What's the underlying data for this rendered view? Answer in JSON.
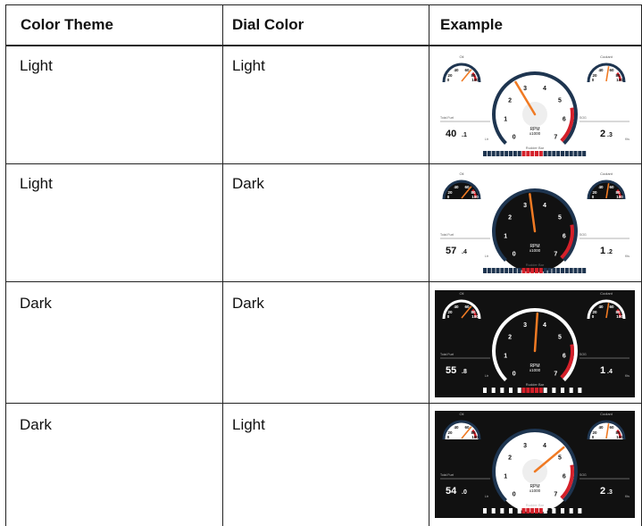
{
  "table": {
    "headers": [
      "Color Theme",
      "Dial Color",
      "Example"
    ],
    "rows": [
      {
        "theme": "Light",
        "dial": "Light"
      },
      {
        "theme": "Light",
        "dial": "Dark"
      },
      {
        "theme": "Dark",
        "dial": "Dark"
      },
      {
        "theme": "Dark",
        "dial": "Light"
      }
    ]
  },
  "gauge_labels": {
    "oil": "Oil",
    "coolant": "Coolant",
    "rpm": "RPM",
    "rpm_unit": "x1000",
    "total_fuel": "Total Fuel",
    "fuel_unit": "Ltr",
    "right_label": "SOG",
    "right_unit": "Kts",
    "rudder": "Rudder Bar",
    "small_ticks": [
      "40",
      "60",
      "20",
      "80",
      "0",
      "100"
    ],
    "rpm_ticks": [
      "0",
      "1",
      "2",
      "3",
      "4",
      "5",
      "6",
      "7"
    ]
  },
  "examples": [
    {
      "fuel_value": "40",
      "fuel_decimal": ".1",
      "right_value": "2",
      "right_decimal": ".3",
      "rpm_level": 2.7,
      "bg": "#ffffff",
      "dial": "#ffffff",
      "fg": "#111111"
    },
    {
      "fuel_value": "57",
      "fuel_decimal": ".4",
      "right_value": "1",
      "right_decimal": ".2",
      "rpm_level": 3.3,
      "bg": "#ffffff",
      "dial": "#111111",
      "fg": "#111111"
    },
    {
      "fuel_value": "55",
      "fuel_decimal": ".8",
      "right_value": "1",
      "right_decimal": ".4",
      "rpm_level": 3.6,
      "bg": "#111111",
      "dial": "#111111",
      "fg": "#ffffff"
    },
    {
      "fuel_value": "54",
      "fuel_decimal": ".0",
      "right_value": "2",
      "right_decimal": ".3",
      "rpm_level": 4.8,
      "bg": "#111111",
      "dial": "#ffffff",
      "fg": "#ffffff"
    }
  ],
  "colors": {
    "needle": "#f07a23",
    "redzone": "#d4202a",
    "navy": "#1e3550"
  }
}
